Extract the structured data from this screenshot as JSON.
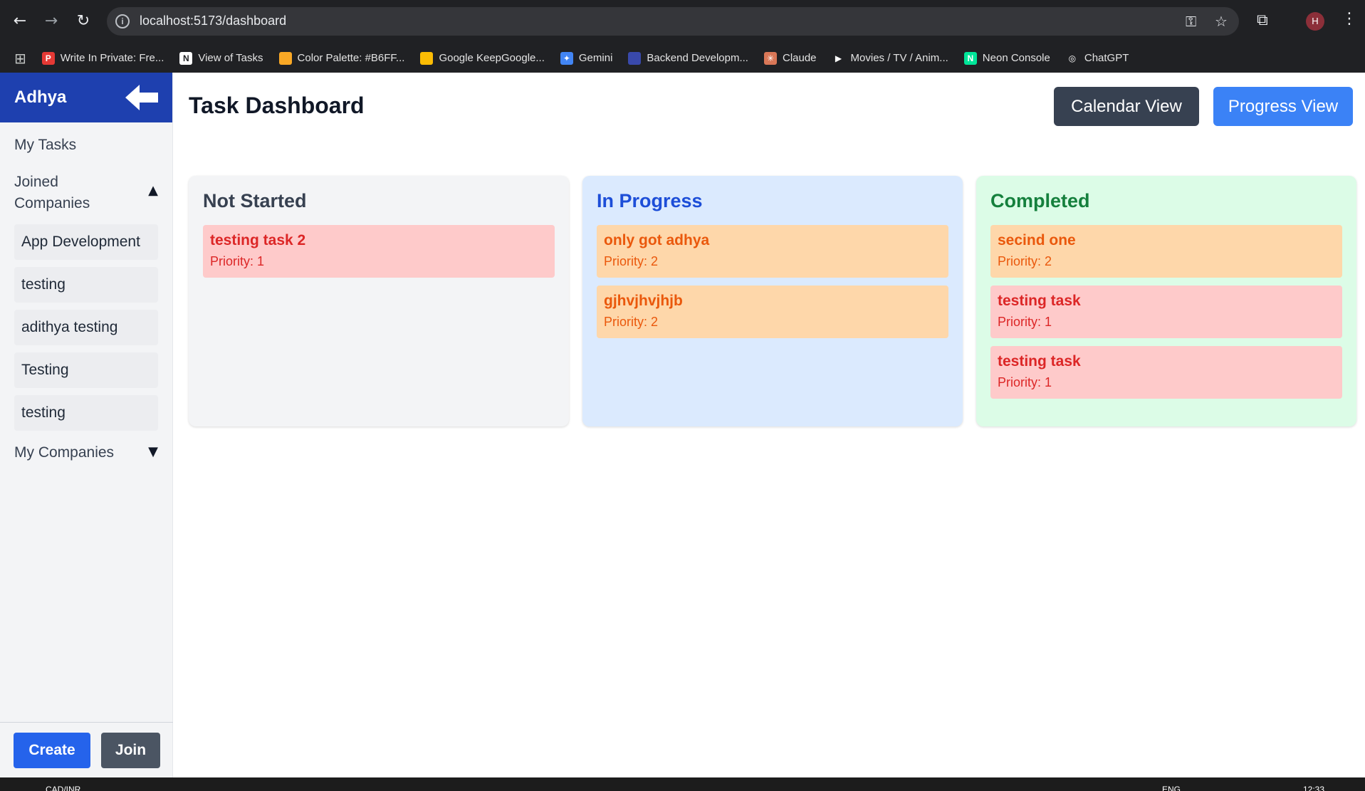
{
  "browser": {
    "url": "localhost:5173/dashboard",
    "profile_initial": "H",
    "bookmarks": [
      {
        "label": "Write In Private: Fre...",
        "icon": "private-write-icon",
        "color": "#e53935",
        "glyph": "P"
      },
      {
        "label": "View of Tasks",
        "icon": "notion-icon",
        "color": "#ffffff",
        "glyph": "N"
      },
      {
        "label": "Color Palette: #B6FF...",
        "icon": "palette-icon",
        "color": "#f9a825",
        "glyph": ""
      },
      {
        "label": "Google KeepGoogle...",
        "icon": "keep-icon",
        "color": "#fbbc04",
        "glyph": ""
      },
      {
        "label": "Gemini",
        "icon": "gemini-icon",
        "color": "#4285f4",
        "glyph": "✦"
      },
      {
        "label": "Backend Developm...",
        "icon": "backend-icon",
        "color": "#3949ab",
        "glyph": ""
      },
      {
        "label": "Claude",
        "icon": "claude-icon",
        "color": "#d97757",
        "glyph": "✳"
      },
      {
        "label": "Movies / TV / Anim...",
        "icon": "play-icon",
        "color": "#202124",
        "glyph": "▶"
      },
      {
        "label": "Neon Console",
        "icon": "neon-icon",
        "color": "#00e599",
        "glyph": "N"
      },
      {
        "label": "ChatGPT",
        "icon": "chatgpt-icon",
        "color": "#202124",
        "glyph": "◎"
      }
    ]
  },
  "sidebar": {
    "title": "Adhya",
    "my_tasks": "My Tasks",
    "joined_companies": "Joined Companies",
    "joined_toggle": "▲",
    "companies": [
      "App Development",
      "testing",
      "adithya testing",
      "Testing",
      "testing"
    ],
    "my_companies": "My Companies",
    "my_companies_toggle": "▼",
    "create_label": "Create",
    "join_label": "Join"
  },
  "header": {
    "title": "Task Dashboard",
    "calendar_view": "Calendar View",
    "progress_view": "Progress View"
  },
  "columns": [
    {
      "title": "Not Started",
      "bg": "#f3f4f6",
      "title_color": "#374151",
      "tasks": [
        {
          "name": "testing task 2",
          "priority": "Priority: 1",
          "tone": "red"
        }
      ]
    },
    {
      "title": "In Progress",
      "bg": "#dbeafe",
      "title_color": "#1d4ed8",
      "tasks": [
        {
          "name": "only got adhya",
          "priority": "Priority: 2",
          "tone": "orange"
        },
        {
          "name": "gjhvjhvjhjb",
          "priority": "Priority: 2",
          "tone": "orange"
        }
      ]
    },
    {
      "title": "Completed",
      "bg": "#dcfce7",
      "title_color": "#15803d",
      "tasks": [
        {
          "name": "secind one",
          "priority": "Priority: 2",
          "tone": "orange"
        },
        {
          "name": "testing task",
          "priority": "Priority: 1",
          "tone": "red"
        },
        {
          "name": "testing task",
          "priority": "Priority: 1",
          "tone": "red"
        }
      ]
    }
  ],
  "taskbar": {
    "ticker": "CAD/INR",
    "lang": "ENG",
    "time": "12:33"
  }
}
